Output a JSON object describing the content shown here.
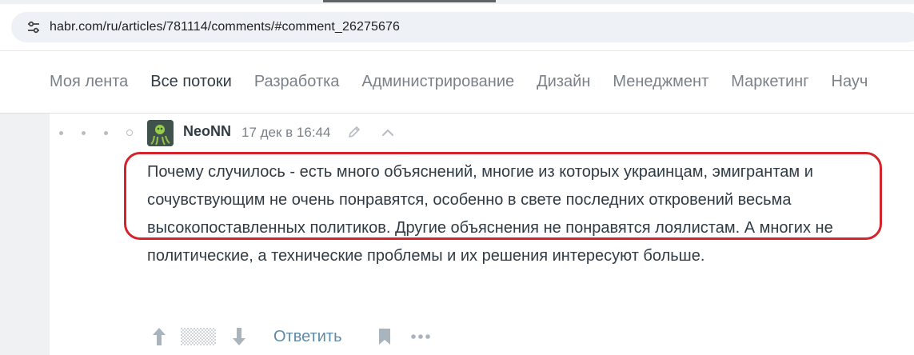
{
  "browser": {
    "url": "habr.com/ru/articles/781114/comments/#comment_26275676",
    "site_info_icon": "tune-icon"
  },
  "nav": {
    "items": [
      {
        "label": "Моя лента",
        "active": false
      },
      {
        "label": "Все потоки",
        "active": true
      },
      {
        "label": "Разработка",
        "active": false
      },
      {
        "label": "Администрирование",
        "active": false
      },
      {
        "label": "Дизайн",
        "active": false
      },
      {
        "label": "Менеджмент",
        "active": false
      },
      {
        "label": "Маркетинг",
        "active": false
      },
      {
        "label": "Науч",
        "active": false
      }
    ]
  },
  "comment": {
    "author": "NeoNN",
    "timestamp": "17 дек в 16:44",
    "text": "Почему случилось - есть много объяснений, многие из которых украинцам, эмигрантам и сочувствующим не очень понравятся, особенно в свете последних откровений весьма высокопоставленных политиков. Другие объяснения не понравятся лоялистам. А многих не политические, а технические проблемы и их решения интересуют больше.",
    "reply_label": "Ответить"
  },
  "colors": {
    "highlight_border": "#d3232b",
    "link": "#5e8aa8",
    "text": "#303b44"
  }
}
